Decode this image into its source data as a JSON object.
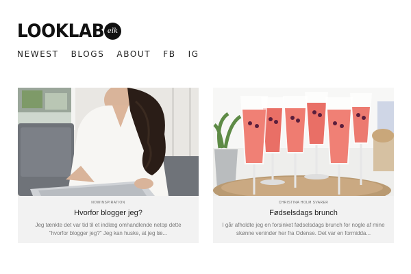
{
  "logo": {
    "text": "LOOKLAB",
    "badge": "elk"
  },
  "nav": [
    "NEWEST",
    "BLOGS",
    "ABOUT",
    "FB",
    "IG"
  ],
  "posts": [
    {
      "category": "NOWINSPIRATION",
      "title": "Hvorfor blogger jeg?",
      "excerpt": "Jeg tænkte det var tid til et indlæg omhandlende netop dette \"hvorfor blogger jeg?\"  Jeg kan huske, at jeg læ...",
      "image": "woman-laptop-photo"
    },
    {
      "category": "CHRISTINA HOLM SVARER",
      "title": "Fødselsdags brunch",
      "excerpt": "I går afholdte jeg en forsinket fødselsdags brunch for nogle af mine skønne veninder her fra Odense. Det var en formidda...",
      "image": "champagne-glasses-photo"
    }
  ],
  "colors": {
    "card_background": "#f2f2f2",
    "text": "#222222",
    "excerpt": "#777777"
  }
}
